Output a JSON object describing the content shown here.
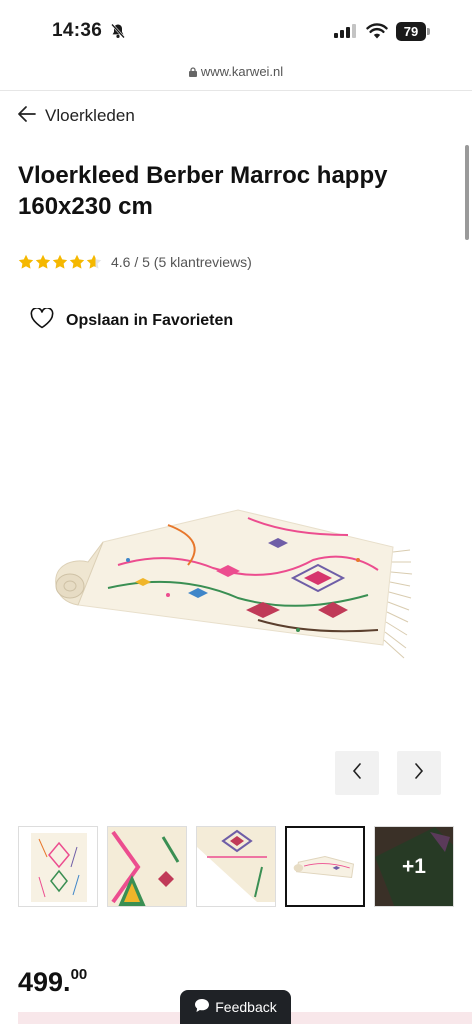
{
  "status_bar": {
    "time": "14:36",
    "battery": "79"
  },
  "browser": {
    "url": "www.karwei.nl"
  },
  "breadcrumb": {
    "back_label": "Vloerkleden"
  },
  "product": {
    "title": "Vloerkleed Berber Marroc happy 160x230 cm",
    "rating_value": 4.6,
    "rating_text": "4.6 / 5 (5 klantreviews)",
    "favorite_label": "Opslaan in Favorieten",
    "price_whole": "499.",
    "price_cents": "00"
  },
  "gallery": {
    "thumbnail_count": 5,
    "active_index": 3,
    "more_label": "+1"
  },
  "feedback_label": "Feedback",
  "colors": {
    "star": "#f5b800",
    "feedback_bg": "#1f2226",
    "price_bar": "#f8e7ea"
  }
}
